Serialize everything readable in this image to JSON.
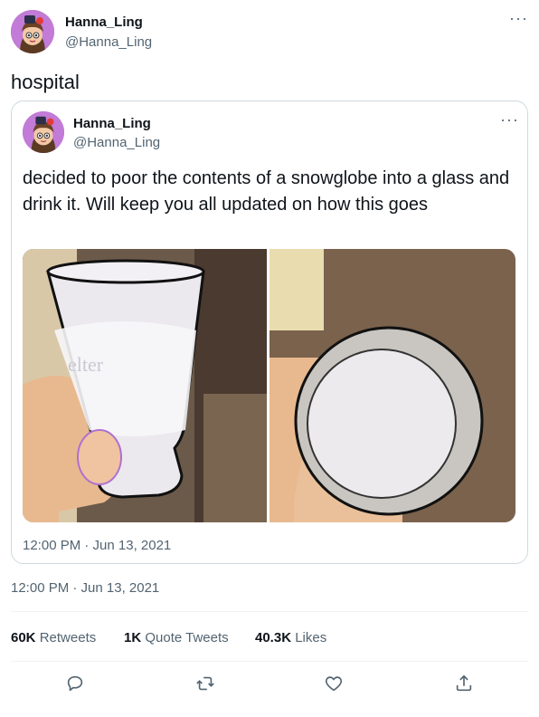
{
  "tweet": {
    "display_name": "Hanna_Ling",
    "handle": "@Hanna_Ling",
    "text": "hospital",
    "timestamp": "12:00 PM · Jun 13, 2021"
  },
  "quoted": {
    "display_name": "Hanna_Ling",
    "handle": "@Hanna_Ling",
    "text": "decided to poor the contents of a snowglobe into a glass and drink it. Will keep you all updated on how this goes",
    "timestamp": "12:00 PM · Jun 13, 2021",
    "glass_print": "elter"
  },
  "stats": {
    "retweets_count": "60K",
    "retweets_label": "Retweets",
    "quotes_count": "1K",
    "quotes_label": "Quote Tweets",
    "likes_count": "40.3K",
    "likes_label": "Likes"
  },
  "actions": [
    {
      "icon": "reply-icon"
    },
    {
      "icon": "retweet-icon"
    },
    {
      "icon": "like-icon"
    },
    {
      "icon": "share-icon"
    }
  ],
  "colors": {
    "text": "#0f1419",
    "secondary": "#536471",
    "border": "#cfd9de",
    "avatar_bg": "#b86fd0"
  }
}
